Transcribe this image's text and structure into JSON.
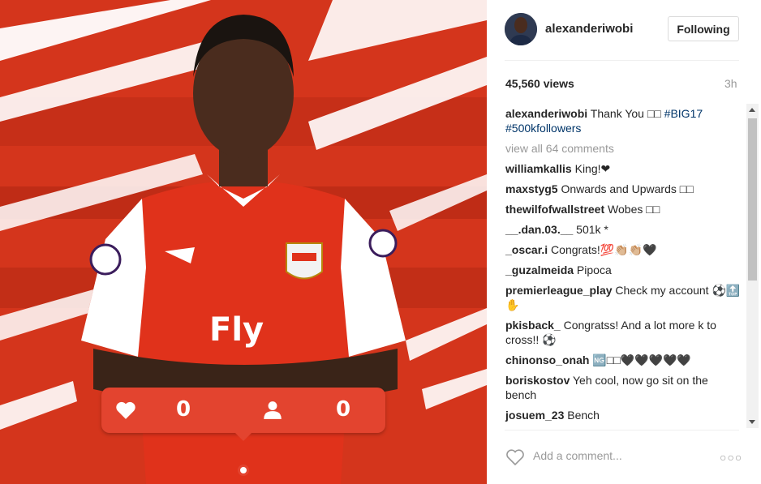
{
  "photo": {
    "like_count": "0",
    "follower_count": "0",
    "shirt_text": "Fly",
    "colors": {
      "red": "#d4351c",
      "bar_red": "#e3442f",
      "white": "#ffffff"
    }
  },
  "post": {
    "username": "alexanderiwobi",
    "follow_label": "Following",
    "views": "45,560 views",
    "time": "3h"
  },
  "caption": {
    "user": "alexanderiwobi",
    "text": "Thank You □□",
    "hashtags": [
      "#BIG17",
      "#500kfollowers"
    ]
  },
  "view_all": "view all 64 comments",
  "comments": [
    {
      "user": "williamkallis",
      "text": "King!❤"
    },
    {
      "user": "maxstyg5",
      "text": "Onwards and Upwards □□"
    },
    {
      "user": "thewilfofwallstreet",
      "text": "Wobes □□"
    },
    {
      "user": "__.dan.03.__",
      "text": "501k *"
    },
    {
      "user": "_oscar.i",
      "text": "Congrats!💯👏🏼👏🏼🖤"
    },
    {
      "user": "_guzalmeida",
      "text": "Pipoca"
    },
    {
      "user": "premierleague_play",
      "text": "Check my account ⚽🔝✋"
    },
    {
      "user": "pkisback_",
      "text": "Congratss! And a lot more k to cross!! ⚽"
    },
    {
      "user": "chinonso_onah",
      "text": "🆖□□🖤🖤🖤🖤🖤"
    },
    {
      "user": "boriskostov",
      "text": "Yeh cool, now go sit on the bench"
    },
    {
      "user": "josuem_23",
      "text": "Bench"
    }
  ],
  "footer": {
    "comment_placeholder": "Add a comment...",
    "like_icon": "heart-outline-icon",
    "more_icon": "more-options-icon"
  }
}
